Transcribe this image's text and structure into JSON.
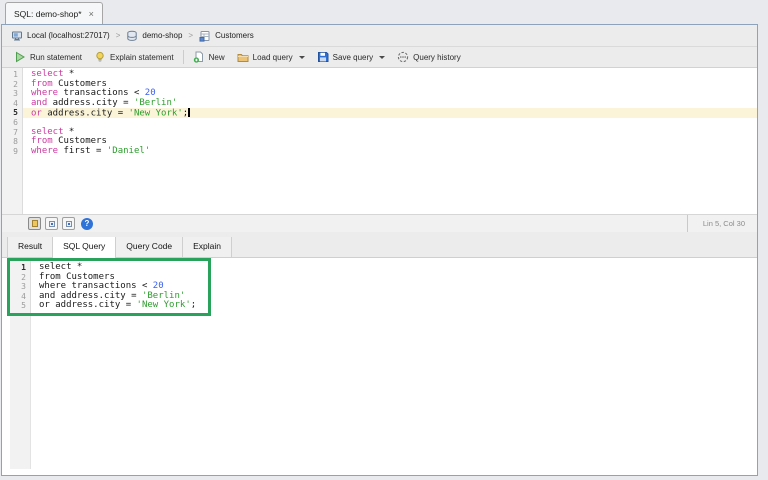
{
  "colors": {
    "accent_green": "#29a25b",
    "keyword": "#cb3aa2",
    "string": "#2c9e2c",
    "number": "#3a5ff0",
    "current_line_bg": "#fbf4d9"
  },
  "tab": {
    "title": "SQL: demo-shop*",
    "close_label": "×"
  },
  "breadcrumb": {
    "separator": ">",
    "items": [
      {
        "label": "Local (localhost:27017)",
        "icon": "server-icon"
      },
      {
        "label": "demo-shop",
        "icon": "database-icon"
      },
      {
        "label": "Customers",
        "icon": "collection-icon"
      }
    ]
  },
  "toolbar": {
    "buttons": [
      {
        "label": "Run statement",
        "icon": "run-icon",
        "dropdown": false
      },
      {
        "label": "Explain statement",
        "icon": "bulb-icon",
        "dropdown": false
      },
      {
        "label": "New",
        "icon": "new-document-icon",
        "dropdown": false
      },
      {
        "label": "Load query",
        "icon": "folder-icon",
        "dropdown": true
      },
      {
        "label": "Save query",
        "icon": "save-icon",
        "dropdown": true
      },
      {
        "label": "Query history",
        "icon": "history-icon",
        "dropdown": false
      }
    ]
  },
  "editor": {
    "current_line": 5,
    "cursor_line": 5,
    "position_status": "Lin 5, Col 30",
    "lines": [
      [
        {
          "t": "select",
          "c": "kw"
        },
        {
          "t": " *",
          "c": "pl"
        }
      ],
      [
        {
          "t": "from",
          "c": "kw"
        },
        {
          "t": " Customers",
          "c": "pl"
        }
      ],
      [
        {
          "t": "where",
          "c": "kw"
        },
        {
          "t": " transactions < ",
          "c": "pl"
        },
        {
          "t": "20",
          "c": "num"
        }
      ],
      [
        {
          "t": "and",
          "c": "kw"
        },
        {
          "t": " address.city = ",
          "c": "pl"
        },
        {
          "t": "'Berlin'",
          "c": "str"
        }
      ],
      [
        {
          "t": "or",
          "c": "kw"
        },
        {
          "t": " address.city = ",
          "c": "pl"
        },
        {
          "t": "'New York'",
          "c": "str"
        },
        {
          "t": ";",
          "c": "pl"
        }
      ],
      [],
      [
        {
          "t": "select",
          "c": "kw"
        },
        {
          "t": " *",
          "c": "pl"
        }
      ],
      [
        {
          "t": "from",
          "c": "kw"
        },
        {
          "t": " Customers",
          "c": "pl"
        }
      ],
      [
        {
          "t": "where",
          "c": "kw"
        },
        {
          "t": " first = ",
          "c": "pl"
        },
        {
          "t": "'Daniel'",
          "c": "str"
        }
      ]
    ]
  },
  "result_tabs": {
    "labels": [
      "Result",
      "SQL Query",
      "Query Code",
      "Explain"
    ],
    "active": "SQL Query"
  },
  "sql_query_panel": {
    "highlight_line": 1,
    "lines": [
      [
        {
          "t": "select *",
          "c": "pl"
        }
      ],
      [
        {
          "t": "from Customers",
          "c": "pl"
        }
      ],
      [
        {
          "t": "where transactions < ",
          "c": "pl"
        },
        {
          "t": "20",
          "c": "num"
        }
      ],
      [
        {
          "t": "and address.city = ",
          "c": "pl"
        },
        {
          "t": "'Berlin'",
          "c": "str"
        }
      ],
      [
        {
          "t": "or address.city = ",
          "c": "pl"
        },
        {
          "t": "'New York'",
          "c": "str"
        },
        {
          "t": ";",
          "c": "pl"
        }
      ]
    ]
  }
}
